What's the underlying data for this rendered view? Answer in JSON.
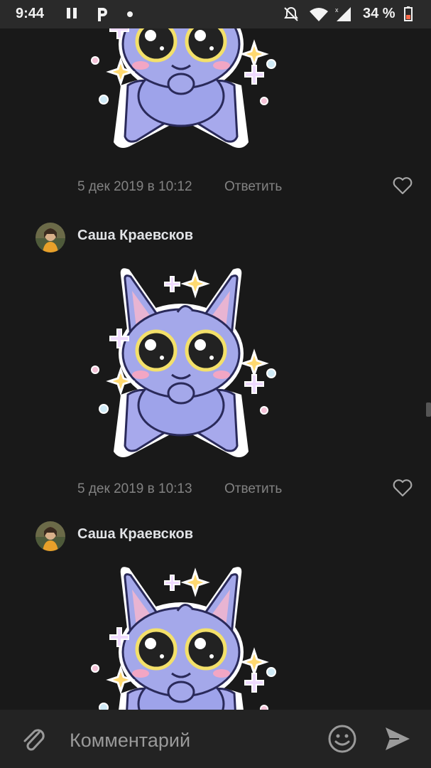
{
  "status_bar": {
    "time": "9:44",
    "battery": "34 %",
    "icons": [
      "pause-icon",
      "p-app-icon",
      "dot-icon",
      "notifications-off-icon",
      "wifi-icon",
      "cellular-icon",
      "battery-icon"
    ]
  },
  "comments": [
    {
      "date": "5 дек 2019 в 10:12",
      "reply": "Ответить"
    },
    {
      "author": "Саша Краевсков",
      "date": "5 дек 2019 в 10:13",
      "reply": "Ответить"
    },
    {
      "author": "Саша Краевсков"
    }
  ],
  "compose": {
    "placeholder": "Комментарий",
    "icons": [
      "attach-icon",
      "emoji-icon",
      "send-icon"
    ]
  },
  "colors": {
    "background": "#191919",
    "text_primary": "#e1e3e6",
    "text_secondary": "#828282",
    "sticker_body": "#a4a8ea",
    "sticker_sparkle_yellow": "#ffd970"
  }
}
